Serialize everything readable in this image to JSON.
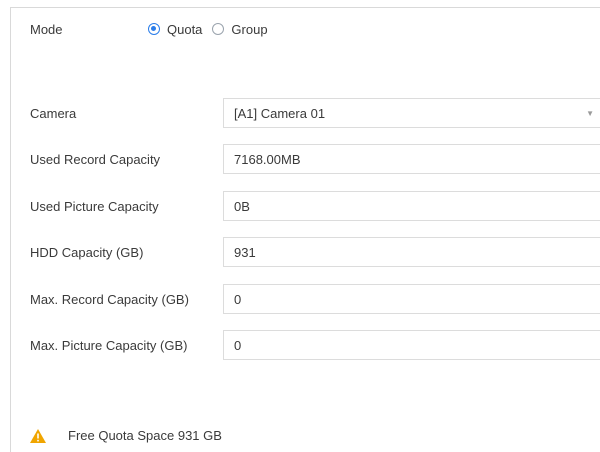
{
  "mode": {
    "label": "Mode",
    "options": [
      {
        "label": "Quota",
        "selected": true
      },
      {
        "label": "Group",
        "selected": false
      }
    ]
  },
  "fields": {
    "camera": {
      "label": "Camera",
      "value": "[A1] Camera 01"
    },
    "used_record": {
      "label": "Used Record Capacity",
      "value": "7168.00MB"
    },
    "used_picture": {
      "label": "Used Picture Capacity",
      "value": "0B"
    },
    "hdd_capacity": {
      "label": "HDD Capacity (GB)",
      "value": "931"
    },
    "max_record": {
      "label": "Max. Record Capacity (GB)",
      "value": "0"
    },
    "max_picture": {
      "label": "Max. Picture Capacity (GB)",
      "value": "0"
    }
  },
  "notice": {
    "icon": "warning-icon",
    "text": "Free Quota Space 931 GB",
    "icon_color": "#f0a500"
  },
  "colors": {
    "accent": "#2b7de9"
  }
}
